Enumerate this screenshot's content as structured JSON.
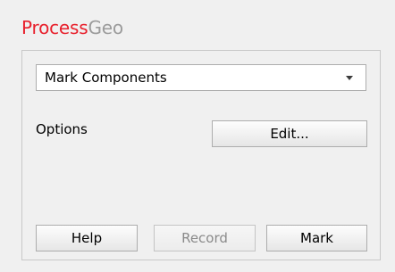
{
  "app": {
    "title_part1": "Process",
    "title_part2": "Geo"
  },
  "dropdown": {
    "selected": "Mark Components"
  },
  "options": {
    "label": "Options",
    "edit_label": "Edit..."
  },
  "footer": {
    "help_label": "Help",
    "record_label": "Record",
    "mark_label": "Mark"
  }
}
